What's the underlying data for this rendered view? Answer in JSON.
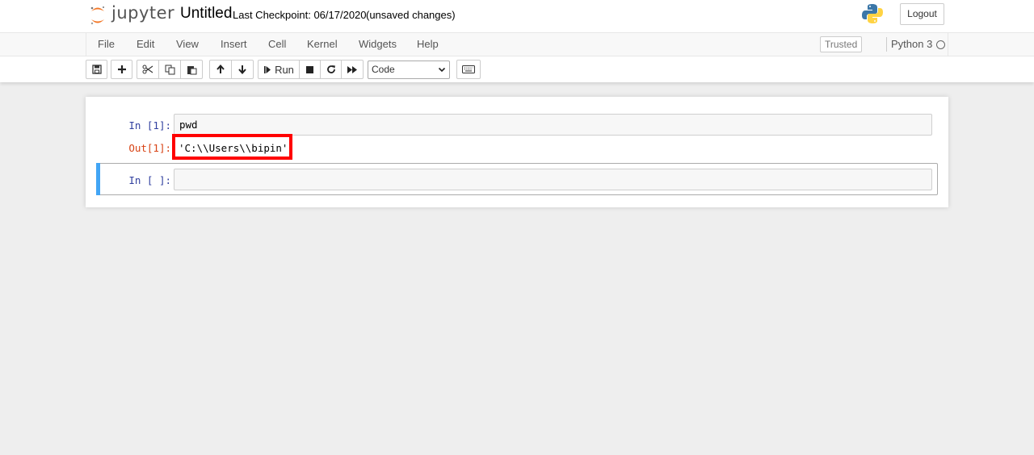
{
  "header": {
    "logo_text": "jupyter",
    "notebook_title": "Untitled",
    "checkpoint": "Last Checkpoint: 06/17/2020",
    "unsaved": "(unsaved changes)",
    "logout_label": "Logout"
  },
  "menubar": {
    "items": [
      "File",
      "Edit",
      "View",
      "Insert",
      "Cell",
      "Kernel",
      "Widgets",
      "Help"
    ],
    "trusted_label": "Trusted",
    "kernel_name": "Python 3"
  },
  "toolbar": {
    "run_label": "Run",
    "cell_type": "Code",
    "icons": [
      "save-icon",
      "plus-icon",
      "cut-icon",
      "copy-icon",
      "paste-icon",
      "arrow-up-icon",
      "arrow-down-icon",
      "step-forward-icon",
      "stop-icon",
      "restart-icon",
      "fast-forward-icon",
      "keyboard-icon"
    ]
  },
  "cells": [
    {
      "in_prompt": "In [1]:",
      "source": "pwd",
      "out_prompt": "Out[1]:",
      "output": "'C:\\\\Users\\\\bipin'"
    },
    {
      "in_prompt": "In [ ]:",
      "source": ""
    }
  ],
  "colors": {
    "in_prompt": "#303F9F",
    "out_prompt": "#D84315",
    "selected_bar": "#42A5F5",
    "highlight": "#FF0000"
  }
}
